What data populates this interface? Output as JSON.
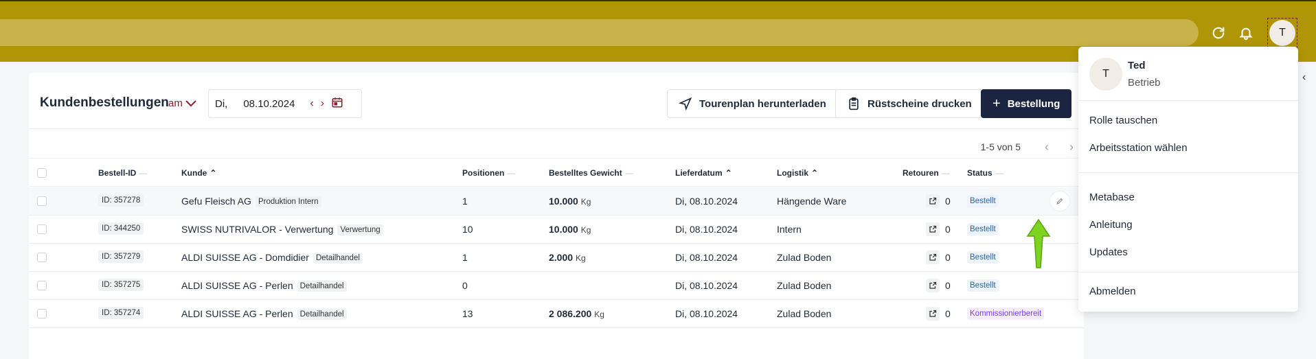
{
  "topbar": {
    "refresh_icon": "refresh-icon",
    "bell_icon": "bell-icon",
    "avatar_initial": "T"
  },
  "page": {
    "title": "Kundenbestellungen",
    "am_label": "am",
    "date_dow": "Di,",
    "date_value": "08.10.2024",
    "btn_tour": "Tourenplan herunterladen",
    "btn_ruest": "Rüstscheine drucken",
    "btn_new": "Bestellung",
    "pager_count": "1-5 von 5"
  },
  "columns": {
    "id": "Bestell-ID",
    "kunde": "Kunde",
    "positionen": "Positionen",
    "gewicht": "Bestelltes Gewicht",
    "lieferdatum": "Lieferdatum",
    "logistik": "Logistik",
    "retouren": "Retouren",
    "status": "Status"
  },
  "rows": [
    {
      "id": "ID: 357278",
      "kunde": "Gefu Fleisch AG",
      "tag": "Produktion Intern",
      "positionen": "1",
      "gewicht": "10.000",
      "unit": "Kg",
      "lieferdatum": "Di, 08.10.2024",
      "logistik": "Hängende Ware",
      "retouren": "0",
      "status": "Bestellt"
    },
    {
      "id": "ID: 344250",
      "kunde": "SWISS NUTRIVALOR - Verwertung",
      "tag": "Verwertung",
      "positionen": "10",
      "gewicht": "10.000",
      "unit": "Kg",
      "lieferdatum": "Di, 08.10.2024",
      "logistik": "Intern",
      "retouren": "0",
      "status": "Bestellt"
    },
    {
      "id": "ID: 357279",
      "kunde": "ALDI SUISSE AG - Domdidier",
      "tag": "Detailhandel",
      "positionen": "1",
      "gewicht": "2.000",
      "unit": "Kg",
      "lieferdatum": "Di, 08.10.2024",
      "logistik": "Zulad Boden",
      "retouren": "0",
      "status": "Bestellt"
    },
    {
      "id": "ID: 357275",
      "kunde": "ALDI SUISSE AG - Perlen",
      "tag": "Detailhandel",
      "positionen": "0",
      "gewicht": "",
      "unit": "",
      "lieferdatum": "Di, 08.10.2024",
      "logistik": "Zulad Boden",
      "retouren": "0",
      "status": "Bestellt"
    },
    {
      "id": "ID: 357274",
      "kunde": "ALDI SUISSE AG - Perlen",
      "tag": "Detailhandel",
      "positionen": "13",
      "gewicht": "2 086.200",
      "unit": "Kg",
      "lieferdatum": "Di, 08.10.2024",
      "logistik": "Zulad Boden",
      "retouren": "0",
      "status": "Kommissionierbereit"
    }
  ],
  "dropdown": {
    "avatar_initial": "T",
    "name": "Ted",
    "role": "Betrieb",
    "items": [
      "Rolle tauschen",
      "Arbeitsstation wählen",
      "Metabase",
      "Anleitung",
      "Updates",
      "Abmelden"
    ]
  },
  "colors": {
    "topbar": "#b09607",
    "primary": "#1b2541",
    "accent": "#8b1d2c",
    "arrow": "#7ed321"
  }
}
